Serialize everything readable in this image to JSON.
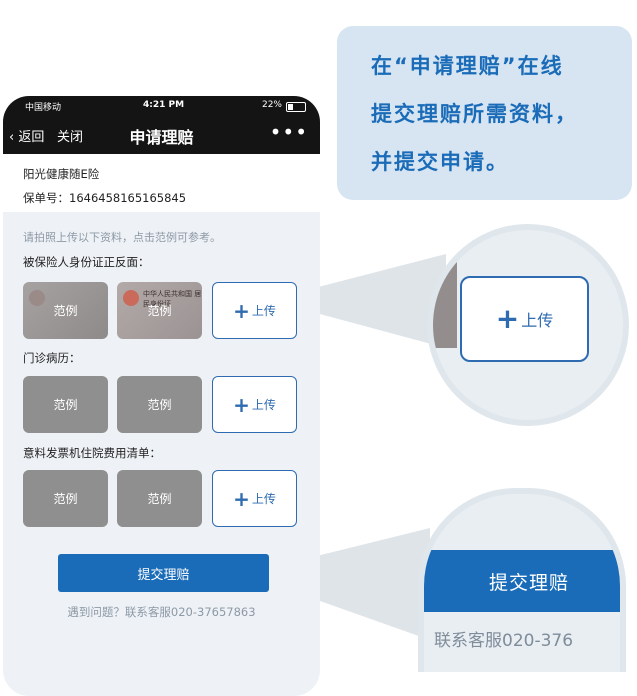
{
  "statusbar": {
    "carrier": "中国移动",
    "time": "4:21 PM",
    "battery": "22%"
  },
  "navbar": {
    "back_label": "返回",
    "close_label": "关闭",
    "title": "申请理赔",
    "more_label": "•••"
  },
  "policy": {
    "name": "阳光健康随E险",
    "number_label": "保单号：1646458165165845"
  },
  "hint": "请拍照上传以下资料，点击范例可参考。",
  "sections": [
    {
      "title": "被保险人身份证正反面：",
      "samples": [
        "范例",
        "范例"
      ],
      "upload_label": "上传"
    },
    {
      "title": "门诊病历：",
      "samples": [
        "范例",
        "范例"
      ],
      "upload_label": "上传"
    },
    {
      "title": "意料发票机住院费用清单：",
      "samples": [
        "范例",
        "范例"
      ],
      "upload_label": "上传"
    }
  ],
  "id_card_text": "中华人民共和国 居民身份证",
  "submit_label": "提交理赔",
  "help_text": "遇到问题？联系客服020-37657863",
  "callout": {
    "lines": [
      "在“申请理赔”在线",
      "提交理赔所需资料，",
      "并提交申请。"
    ]
  },
  "magnifier_upload_label": "上传",
  "magnifier_submit_label": "提交理赔",
  "magnifier_help_text": "联系客服020-376",
  "colors": {
    "accent": "#1a6bb8",
    "navbar": "#141414",
    "callout_bg": "#d7e5f2"
  }
}
